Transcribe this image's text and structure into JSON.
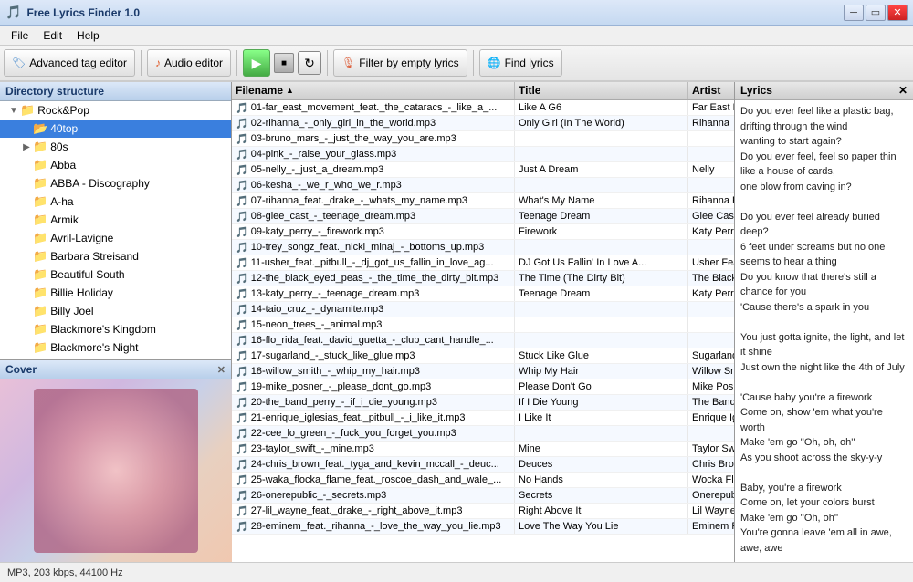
{
  "window": {
    "title": "Free Lyrics Finder 1.0",
    "controls": [
      "minimize",
      "restore",
      "close"
    ]
  },
  "menu": {
    "items": [
      "File",
      "Edit",
      "Help"
    ]
  },
  "toolbar": {
    "advanced_tag_editor": "Advanced tag editor",
    "audio_editor": "Audio editor",
    "play": "Play",
    "filter_label": "Filter by empty lyrics",
    "find_lyrics": "Find lyrics"
  },
  "directory": {
    "header": "Directory structure",
    "root": "Rock&Pop",
    "items": [
      {
        "label": "40top",
        "level": 1,
        "selected": true
      },
      {
        "label": "80s",
        "level": 1,
        "selected": false
      },
      {
        "label": "Abba",
        "level": 1,
        "selected": false
      },
      {
        "label": "ABBA - Discography",
        "level": 1,
        "selected": false
      },
      {
        "label": "A-ha",
        "level": 1,
        "selected": false
      },
      {
        "label": "Armik",
        "level": 1,
        "selected": false
      },
      {
        "label": "Avril-Lavigne",
        "level": 1,
        "selected": false
      },
      {
        "label": "Barbara Streisand",
        "level": 1,
        "selected": false
      },
      {
        "label": "Beautiful South",
        "level": 1,
        "selected": false
      },
      {
        "label": "Billie Holiday",
        "level": 1,
        "selected": false
      },
      {
        "label": "Billy Joel",
        "level": 1,
        "selected": false
      },
      {
        "label": "Blackmore's Kingdom",
        "level": 1,
        "selected": false
      },
      {
        "label": "Blackmore's Night",
        "level": 1,
        "selected": false
      }
    ]
  },
  "cover": {
    "header": "Cover"
  },
  "file_list": {
    "columns": [
      {
        "label": "Filename",
        "sort": "asc"
      },
      {
        "label": "Title",
        "sort": "none"
      },
      {
        "label": "Artist",
        "sort": "none"
      }
    ],
    "rows": [
      {
        "filename": "01-far_east_movement_feat._the_cataracs_-_like_a_...",
        "title": "Like A G6",
        "artist": "Far East Move",
        "alt": false
      },
      {
        "filename": "02-rihanna_-_only_girl_in_the_world.mp3",
        "title": "Only Girl (In The World)",
        "artist": "Rihanna",
        "alt": true
      },
      {
        "filename": "03-bruno_mars_-_just_the_way_you_are.mp3",
        "title": "",
        "artist": "",
        "alt": false
      },
      {
        "filename": "04-pink_-_raise_your_glass.mp3",
        "title": "",
        "artist": "",
        "alt": true
      },
      {
        "filename": "05-nelly_-_just_a_dream.mp3",
        "title": "Just A Dream",
        "artist": "Nelly",
        "alt": false
      },
      {
        "filename": "06-kesha_-_we_r_who_we_r.mp3",
        "title": "",
        "artist": "",
        "alt": true
      },
      {
        "filename": "07-rihanna_feat._drake_-_whats_my_name.mp3",
        "title": "What's My Name",
        "artist": "Rihanna Feat.",
        "alt": false
      },
      {
        "filename": "08-glee_cast_-_teenage_dream.mp3",
        "title": "Teenage Dream",
        "artist": "Glee Cast",
        "alt": true
      },
      {
        "filename": "09-katy_perry_-_firework.mp3",
        "title": "Firework",
        "artist": "Katy Perry",
        "alt": false
      },
      {
        "filename": "10-trey_songz_feat._nicki_minaj_-_bottoms_up.mp3",
        "title": "",
        "artist": "",
        "alt": true
      },
      {
        "filename": "11-usher_feat._pitbull_-_dj_got_us_fallin_in_love_ag...",
        "title": "DJ Got Us Fallin' In Love A...",
        "artist": "Usher Feat. Pi",
        "alt": false
      },
      {
        "filename": "12-the_black_eyed_peas_-_the_time_the_dirty_bit.mp3",
        "title": "The Time (The Dirty Bit)",
        "artist": "The Black Eye",
        "alt": true
      },
      {
        "filename": "13-katy_perry_-_teenage_dream.mp3",
        "title": "Teenage Dream",
        "artist": "Katy Perry",
        "alt": false
      },
      {
        "filename": "14-taio_cruz_-_dynamite.mp3",
        "title": "",
        "artist": "",
        "alt": true
      },
      {
        "filename": "15-neon_trees_-_animal.mp3",
        "title": "",
        "artist": "",
        "alt": false
      },
      {
        "filename": "16-flo_rida_feat._david_guetta_-_club_cant_handle_...",
        "title": "",
        "artist": "",
        "alt": true
      },
      {
        "filename": "17-sugarland_-_stuck_like_glue.mp3",
        "title": "Stuck Like Glue",
        "artist": "Sugarland",
        "alt": false
      },
      {
        "filename": "18-willow_smith_-_whip_my_hair.mp3",
        "title": "Whip My Hair",
        "artist": "Willow Smith",
        "alt": true
      },
      {
        "filename": "19-mike_posner_-_please_dont_go.mp3",
        "title": "Please Don't Go",
        "artist": "Mike Posner",
        "alt": false
      },
      {
        "filename": "20-the_band_perry_-_if_i_die_young.mp3",
        "title": "If I Die Young",
        "artist": "The Band Perr",
        "alt": true
      },
      {
        "filename": "21-enrique_iglesias_feat._pitbull_-_i_like_it.mp3",
        "title": "I Like It",
        "artist": "Enrique Iglesia",
        "alt": false
      },
      {
        "filename": "22-cee_lo_green_-_fuck_you_forget_you.mp3",
        "title": "",
        "artist": "",
        "alt": true
      },
      {
        "filename": "23-taylor_swift_-_mine.mp3",
        "title": "Mine",
        "artist": "Taylor Swift",
        "alt": false
      },
      {
        "filename": "24-chris_brown_feat._tyga_and_kevin_mccall_-_deuc...",
        "title": "Deuces",
        "artist": "Chris Brown Fe",
        "alt": true
      },
      {
        "filename": "25-waka_flocka_flame_feat._roscoe_dash_and_wale_...",
        "title": "No Hands",
        "artist": "Wocka Flocka F",
        "alt": false
      },
      {
        "filename": "26-onerepublic_-_secrets.mp3",
        "title": "Secrets",
        "artist": "Onerepublic",
        "alt": true
      },
      {
        "filename": "27-lil_wayne_feat._drake_-_right_above_it.mp3",
        "title": "Right Above It",
        "artist": "Lil Wayne Fea",
        "alt": false
      },
      {
        "filename": "28-eminem_feat._rihanna_-_love_the_way_you_lie.mp3",
        "title": "Love The Way You Lie",
        "artist": "Eminem Feat.",
        "alt": true
      }
    ]
  },
  "lyrics": {
    "header": "Lyrics",
    "content": "Do you ever feel like a plastic bag,\ndrifting through the wind\nwanting to start again?\nDo you ever feel, feel so paper thin\nlike a house of cards,\none blow from caving in?\n\nDo you ever feel already buried deep?\n6 feet under screams but no one\nseems to hear a thing\nDo you know that there's still a\nchance for you\n'Cause there's a spark in you\n\nYou just gotta ignite, the light, and let\nit shine\nJust own the night like the 4th of July\n\n'Cause baby you're a firework\nCome on, show 'em what you're\nworth\nMake 'em go ''Oh, oh, oh''\nAs you shoot across the sky-y-y\n\nBaby, you're a firework\nCome on, let your colors burst\nMake 'em go ''Oh, oh''\nYou're gonna leave 'em all in awe,\nawe, awe\n\nYou don't have to feel like a waste of\nspace\nYou're original, cannot be replaced\nIf you only knew what the future\nholds\nAfter a hurricane comes a rainbow"
  },
  "status": {
    "text": "MP3, 203 kbps, 44100 Hz"
  }
}
